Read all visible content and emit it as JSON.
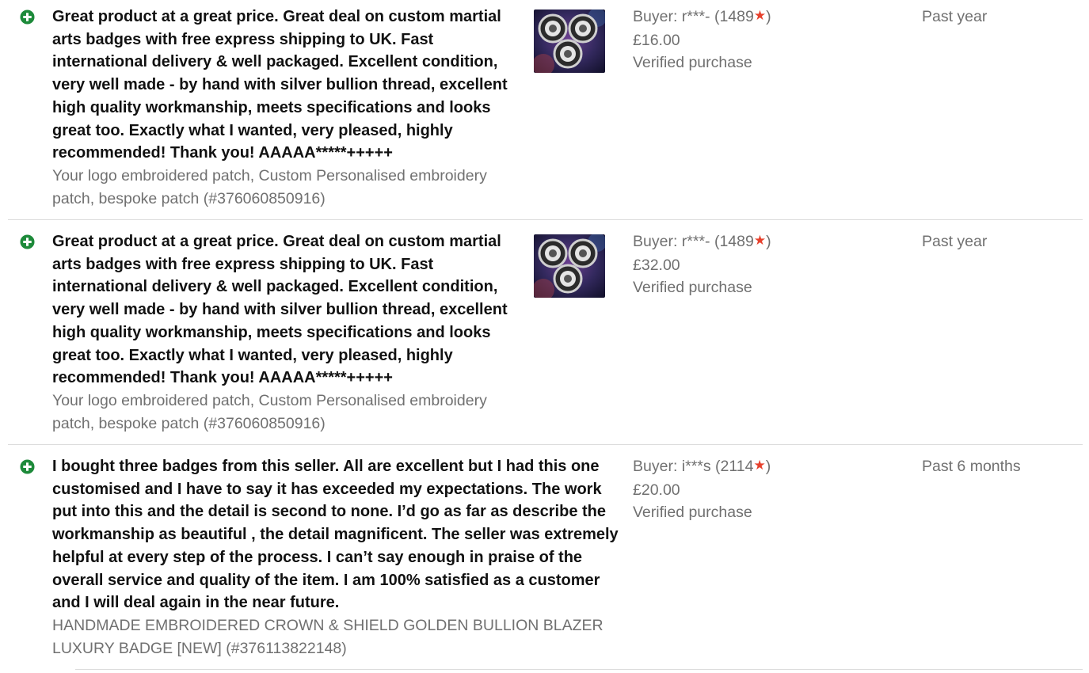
{
  "feedback": [
    {
      "rating": "positive",
      "rating_icon": "plus-circle-icon",
      "comment": "Great product at a great price. Great deal on custom martial arts badges with free express shipping to UK. Fast international delivery & well packaged. Excellent condition, very well made - by hand with silver bullion thread, excellent high quality workmanship, meets specifications and looks great too. Exactly what I wanted, very pleased, highly recommended! Thank you! AAAAA*****+++++",
      "item_title": "Your logo embroidered patch, Custom Personalised embroidery patch, bespoke patch (#376060850916)",
      "has_thumbnail": true,
      "buyer_prefix": "Buyer: r***- (1489",
      "buyer_suffix": ")",
      "star_icon": "★",
      "price": "£16.00",
      "verified": "Verified purchase",
      "period": "Past year"
    },
    {
      "rating": "positive",
      "rating_icon": "plus-circle-icon",
      "comment": "Great product at a great price. Great deal on custom martial arts badges with free express shipping to UK. Fast international delivery & well packaged. Excellent condition, very well made - by hand with silver bullion thread, excellent high quality workmanship, meets specifications and looks great too. Exactly what I wanted, very pleased, highly recommended! Thank you! AAAAA*****+++++",
      "item_title": "Your logo embroidered patch, Custom Personalised embroidery patch, bespoke patch (#376060850916)",
      "has_thumbnail": true,
      "buyer_prefix": "Buyer: r***- (1489",
      "buyer_suffix": ")",
      "star_icon": "★",
      "price": "£32.00",
      "verified": "Verified purchase",
      "period": "Past year"
    },
    {
      "rating": "positive",
      "rating_icon": "plus-circle-icon",
      "comment": "I bought three badges from this seller. All are excellent but I had this one customised and I have to say it has exceeded my expectations. The work put into this and the detail is second to none. I’d go as far as describe the workmanship as beautiful , the detail magnificent. The seller was extremely helpful at every step of the process. I can’t say enough in praise of the overall service and quality of the item. I am 100% satisfied as a customer and I will deal again in the near future.",
      "item_title": "HANDMADE EMBROIDERED CROWN & SHIELD GOLDEN BULLION BLAZER LUXURY BADGE [NEW] (#376113822148)",
      "has_thumbnail": false,
      "buyer_prefix": "Buyer: i***s (2114",
      "buyer_suffix": ")",
      "star_icon": "★",
      "price": "£20.00",
      "verified": "Verified purchase",
      "period": "Past 6 months"
    }
  ],
  "colors": {
    "positive_green": "#1d8a3a",
    "star_red": "#e7402c",
    "secondary_text": "#707070",
    "divider": "#dcdcdc"
  }
}
